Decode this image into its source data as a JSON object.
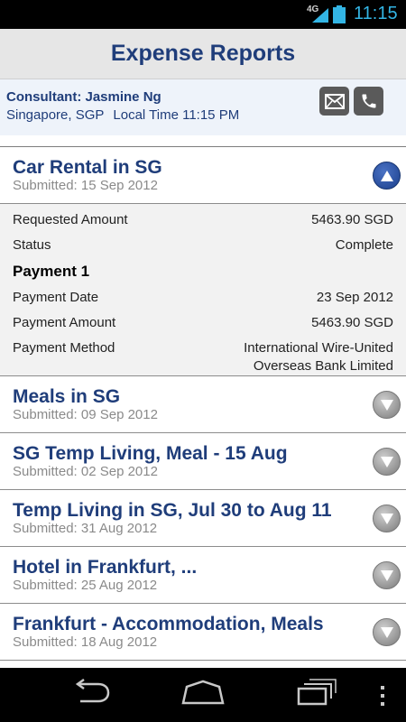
{
  "status_bar": {
    "network": "4G",
    "time": "11:15"
  },
  "header": {
    "title": "Expense Reports"
  },
  "consultant": {
    "name_line": "Consultant: Jasmine Ng",
    "location": "Singapore, SGP",
    "local_time": "Local Time 11:15 PM"
  },
  "reports": [
    {
      "title": "Car Rental in SG",
      "submitted": "Submitted: 15 Sep 2012",
      "expanded": true
    },
    {
      "title": "Meals in SG",
      "submitted": "Submitted: 09 Sep 2012",
      "expanded": false
    },
    {
      "title": "SG Temp Living, Meal - 15 Aug",
      "submitted": "Submitted: 02 Sep 2012",
      "expanded": false
    },
    {
      "title": "Temp Living in SG, Jul 30 to Aug 11",
      "submitted": "Submitted: 31 Aug 2012",
      "expanded": false
    },
    {
      "title": "Hotel in Frankfurt, ...",
      "submitted": "Submitted: 25 Aug 2012",
      "expanded": false
    },
    {
      "title": "Frankfurt - Accommodation, Meals",
      "submitted": "Submitted: 18 Aug 2012",
      "expanded": false
    }
  ],
  "details": {
    "requested_label": "Requested Amount",
    "requested_value": "5463.90 SGD",
    "status_label": "Status",
    "status_value": "Complete",
    "payment_heading": "Payment 1",
    "payment_date_label": "Payment Date",
    "payment_date_value": "23 Sep 2012",
    "payment_amount_label": "Payment Amount",
    "payment_amount_value": "5463.90 SGD",
    "payment_method_label": "Payment Method",
    "payment_method_line1": "International Wire-United",
    "payment_method_line2": "Overseas Bank Limited"
  },
  "colors": {
    "accent": "#1f3d7a",
    "clock": "#33b5e5",
    "expanded_toggle": "#1b3f8c"
  },
  "icons": {
    "mail": "mail-icon",
    "phone": "phone-icon",
    "back": "back-icon",
    "home": "home-icon",
    "recents": "recents-icon",
    "menu": "overflow-menu-icon"
  }
}
